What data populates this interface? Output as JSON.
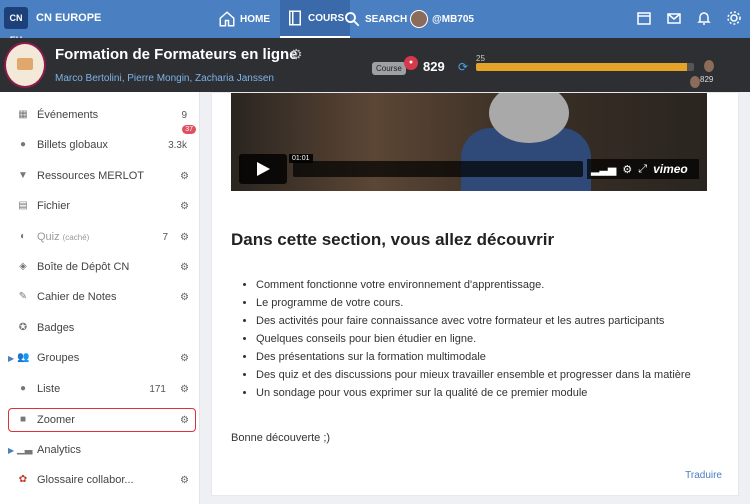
{
  "topnav": {
    "logo": "CN EU",
    "brand": "CN EUROPE",
    "home": "HOME",
    "cours": "COURS",
    "search": "SEARCH",
    "user": "@MB705",
    "icons": [
      "calendar-icon",
      "mail-icon",
      "bell-icon",
      "gear-icon"
    ]
  },
  "course": {
    "title": "Formation de Formateurs en ligne",
    "authors": "Marco Bertolini, Pierre Mongin, Zacharia Janssen",
    "badge_label": "Course",
    "points": "829",
    "progress_start": "25",
    "progress_end": "829",
    "progress_fraction": 0.97
  },
  "sidebar": {
    "items": [
      {
        "label": "Événements",
        "count": "9",
        "icon": "calendar-icon"
      },
      {
        "label": "Billets globaux",
        "count": "3.3k",
        "badge": "37",
        "icon": "globe-icon"
      },
      {
        "label": "Ressources MERLOT",
        "icon": "merlot-icon"
      },
      {
        "label": "Fichier",
        "icon": "file-icon"
      },
      {
        "label": "Quiz",
        "sub": "(caché)",
        "count": "7",
        "icon": "quiz-icon"
      },
      {
        "label": "Boîte de Dépôt CN",
        "icon": "box-icon"
      },
      {
        "label": "Cahier de Notes",
        "icon": "notes-icon"
      },
      {
        "label": "Badges",
        "icon": "badge-icon"
      },
      {
        "label": "Groupes",
        "icon": "group-icon"
      },
      {
        "label": "Liste",
        "count": "171",
        "icon": "person-icon"
      },
      {
        "label": "Zoomer",
        "icon": "video-camera-icon"
      },
      {
        "label": "Analytics",
        "icon": "chart-icon"
      },
      {
        "label": "Glossaire collabor...",
        "icon": "glossary-icon"
      }
    ]
  },
  "video": {
    "time": "01:01",
    "brand": "vimeo"
  },
  "main": {
    "section_title": "Dans cette section, vous allez découvrir",
    "bullets": [
      "Comment fonctionne votre environnement d'apprentissage.",
      "Le programme de votre cours.",
      "Des activités pour faire connaissance avec votre formateur et les autres participants",
      "Quelques conseils pour bien étudier en ligne.",
      "Des présentations sur la formation multimodale",
      "Des quiz et des discussions pour mieux travailler ensemble et progresser dans la matière",
      "Un sondage pour vous exprimer sur la qualité de ce premier module"
    ],
    "closing": "Bonne découverte ;)",
    "translate": "Traduire"
  }
}
